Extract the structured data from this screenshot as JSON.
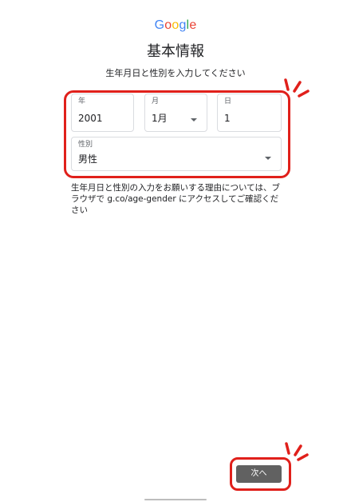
{
  "logo": {
    "text": "Google",
    "letters": [
      {
        "char": "G",
        "color": "#4285F4"
      },
      {
        "char": "o",
        "color": "#EA4335"
      },
      {
        "char": "o",
        "color": "#FBBC05"
      },
      {
        "char": "g",
        "color": "#4285F4"
      },
      {
        "char": "l",
        "color": "#34A853"
      },
      {
        "char": "e",
        "color": "#EA4335"
      }
    ]
  },
  "header": {
    "title": "基本情報",
    "subtitle": "生年月日と性別を入力してください"
  },
  "form": {
    "year": {
      "label": "年",
      "value": "2001"
    },
    "month": {
      "label": "月",
      "value": "1月"
    },
    "day": {
      "label": "日",
      "value": "1"
    },
    "gender": {
      "label": "性別",
      "value": "男性"
    }
  },
  "info_text": "生年月日と性別の入力をお願いする理由については、ブラウザで g.co/age-gender にアクセスしてご確認ください",
  "footer": {
    "next_label": "次へ"
  },
  "colors": {
    "annotation": "#e0201b",
    "button": "#616161",
    "field_border": "#dadce0"
  }
}
